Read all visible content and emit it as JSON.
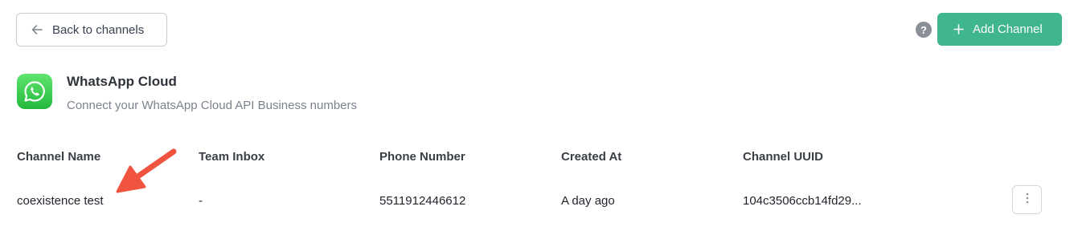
{
  "header": {
    "back_label": "Back to channels",
    "help_symbol": "?",
    "add_label": "Add Channel"
  },
  "channel_type": {
    "title": "WhatsApp Cloud",
    "subtitle": "Connect your WhatsApp Cloud API Business numbers"
  },
  "table": {
    "columns": [
      "Channel Name",
      "Team Inbox",
      "Phone Number",
      "Created At",
      "Channel UUID"
    ],
    "rows": [
      {
        "channel_name": "coexistence test",
        "team_inbox": "-",
        "phone_number": "5511912446612",
        "created_at": "A day ago",
        "channel_uuid": "104c3506ccb14fd29..."
      }
    ]
  },
  "colors": {
    "accent": "#3fb68b",
    "whatsapp_green": "#25d366",
    "annotation_arrow": "#f0533e"
  },
  "icons": {
    "back": "arrow-left-icon",
    "help": "question-circle-icon",
    "add": "plus-icon",
    "logo": "whatsapp-logo-icon",
    "row_menu": "more-vertical-icon"
  }
}
